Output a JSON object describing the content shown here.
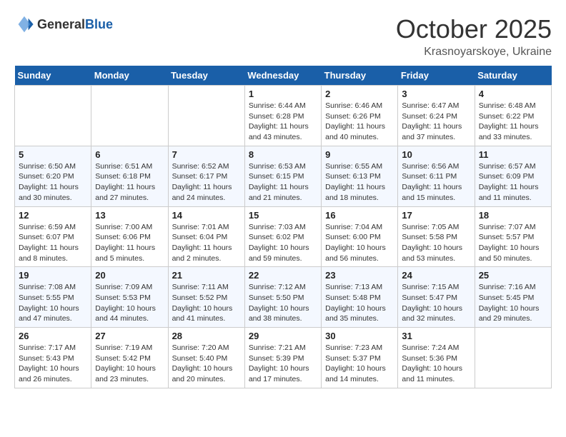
{
  "header": {
    "logo": {
      "general": "General",
      "blue": "Blue"
    },
    "title": "October 2025",
    "location": "Krasnoyarskoye, Ukraine"
  },
  "weekdays": [
    "Sunday",
    "Monday",
    "Tuesday",
    "Wednesday",
    "Thursday",
    "Friday",
    "Saturday"
  ],
  "weeks": [
    [
      {
        "day": "",
        "info": ""
      },
      {
        "day": "",
        "info": ""
      },
      {
        "day": "",
        "info": ""
      },
      {
        "day": "1",
        "info": "Sunrise: 6:44 AM\nSunset: 6:28 PM\nDaylight: 11 hours\nand 43 minutes."
      },
      {
        "day": "2",
        "info": "Sunrise: 6:46 AM\nSunset: 6:26 PM\nDaylight: 11 hours\nand 40 minutes."
      },
      {
        "day": "3",
        "info": "Sunrise: 6:47 AM\nSunset: 6:24 PM\nDaylight: 11 hours\nand 37 minutes."
      },
      {
        "day": "4",
        "info": "Sunrise: 6:48 AM\nSunset: 6:22 PM\nDaylight: 11 hours\nand 33 minutes."
      }
    ],
    [
      {
        "day": "5",
        "info": "Sunrise: 6:50 AM\nSunset: 6:20 PM\nDaylight: 11 hours\nand 30 minutes."
      },
      {
        "day": "6",
        "info": "Sunrise: 6:51 AM\nSunset: 6:18 PM\nDaylight: 11 hours\nand 27 minutes."
      },
      {
        "day": "7",
        "info": "Sunrise: 6:52 AM\nSunset: 6:17 PM\nDaylight: 11 hours\nand 24 minutes."
      },
      {
        "day": "8",
        "info": "Sunrise: 6:53 AM\nSunset: 6:15 PM\nDaylight: 11 hours\nand 21 minutes."
      },
      {
        "day": "9",
        "info": "Sunrise: 6:55 AM\nSunset: 6:13 PM\nDaylight: 11 hours\nand 18 minutes."
      },
      {
        "day": "10",
        "info": "Sunrise: 6:56 AM\nSunset: 6:11 PM\nDaylight: 11 hours\nand 15 minutes."
      },
      {
        "day": "11",
        "info": "Sunrise: 6:57 AM\nSunset: 6:09 PM\nDaylight: 11 hours\nand 11 minutes."
      }
    ],
    [
      {
        "day": "12",
        "info": "Sunrise: 6:59 AM\nSunset: 6:07 PM\nDaylight: 11 hours\nand 8 minutes."
      },
      {
        "day": "13",
        "info": "Sunrise: 7:00 AM\nSunset: 6:06 PM\nDaylight: 11 hours\nand 5 minutes."
      },
      {
        "day": "14",
        "info": "Sunrise: 7:01 AM\nSunset: 6:04 PM\nDaylight: 11 hours\nand 2 minutes."
      },
      {
        "day": "15",
        "info": "Sunrise: 7:03 AM\nSunset: 6:02 PM\nDaylight: 10 hours\nand 59 minutes."
      },
      {
        "day": "16",
        "info": "Sunrise: 7:04 AM\nSunset: 6:00 PM\nDaylight: 10 hours\nand 56 minutes."
      },
      {
        "day": "17",
        "info": "Sunrise: 7:05 AM\nSunset: 5:58 PM\nDaylight: 10 hours\nand 53 minutes."
      },
      {
        "day": "18",
        "info": "Sunrise: 7:07 AM\nSunset: 5:57 PM\nDaylight: 10 hours\nand 50 minutes."
      }
    ],
    [
      {
        "day": "19",
        "info": "Sunrise: 7:08 AM\nSunset: 5:55 PM\nDaylight: 10 hours\nand 47 minutes."
      },
      {
        "day": "20",
        "info": "Sunrise: 7:09 AM\nSunset: 5:53 PM\nDaylight: 10 hours\nand 44 minutes."
      },
      {
        "day": "21",
        "info": "Sunrise: 7:11 AM\nSunset: 5:52 PM\nDaylight: 10 hours\nand 41 minutes."
      },
      {
        "day": "22",
        "info": "Sunrise: 7:12 AM\nSunset: 5:50 PM\nDaylight: 10 hours\nand 38 minutes."
      },
      {
        "day": "23",
        "info": "Sunrise: 7:13 AM\nSunset: 5:48 PM\nDaylight: 10 hours\nand 35 minutes."
      },
      {
        "day": "24",
        "info": "Sunrise: 7:15 AM\nSunset: 5:47 PM\nDaylight: 10 hours\nand 32 minutes."
      },
      {
        "day": "25",
        "info": "Sunrise: 7:16 AM\nSunset: 5:45 PM\nDaylight: 10 hours\nand 29 minutes."
      }
    ],
    [
      {
        "day": "26",
        "info": "Sunrise: 7:17 AM\nSunset: 5:43 PM\nDaylight: 10 hours\nand 26 minutes."
      },
      {
        "day": "27",
        "info": "Sunrise: 7:19 AM\nSunset: 5:42 PM\nDaylight: 10 hours\nand 23 minutes."
      },
      {
        "day": "28",
        "info": "Sunrise: 7:20 AM\nSunset: 5:40 PM\nDaylight: 10 hours\nand 20 minutes."
      },
      {
        "day": "29",
        "info": "Sunrise: 7:21 AM\nSunset: 5:39 PM\nDaylight: 10 hours\nand 17 minutes."
      },
      {
        "day": "30",
        "info": "Sunrise: 7:23 AM\nSunset: 5:37 PM\nDaylight: 10 hours\nand 14 minutes."
      },
      {
        "day": "31",
        "info": "Sunrise: 7:24 AM\nSunset: 5:36 PM\nDaylight: 10 hours\nand 11 minutes."
      },
      {
        "day": "",
        "info": ""
      }
    ]
  ]
}
